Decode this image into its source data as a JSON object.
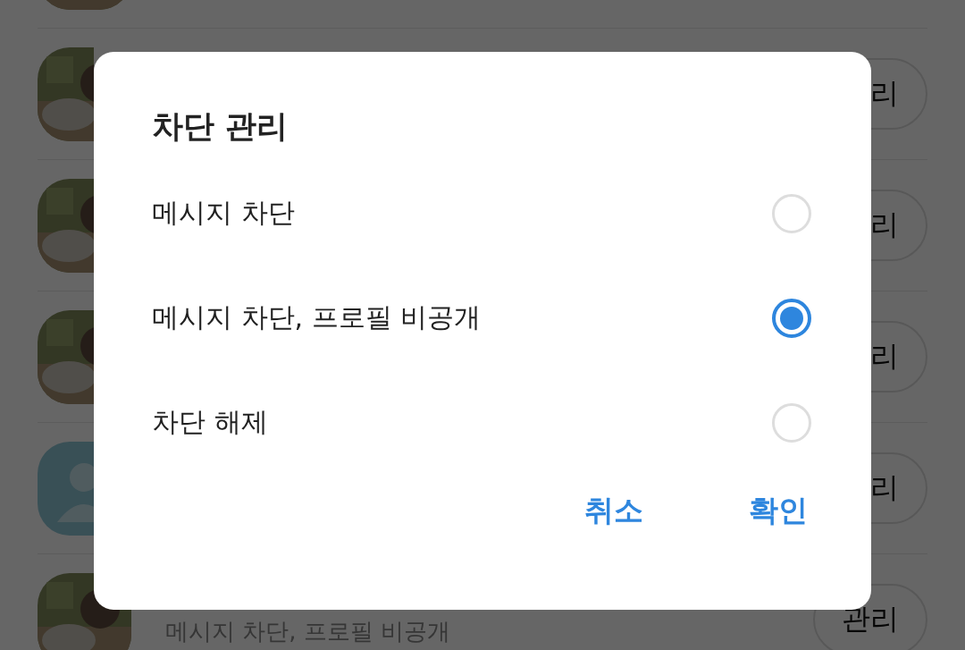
{
  "background_list": {
    "rows": [
      {
        "avatar": {
          "kind": "picture"
        }
      },
      {
        "avatar": {
          "kind": "picture"
        },
        "manage_button": "리"
      },
      {
        "avatar": {
          "kind": "picture"
        },
        "manage_button": "리"
      },
      {
        "avatar": {
          "kind": "picture"
        },
        "manage_button": "리"
      },
      {
        "avatar": {
          "kind": "person"
        },
        "manage_button": "리"
      },
      {
        "avatar": {
          "kind": "picture"
        },
        "manage_button": "관리",
        "subtitle": "메시지 차단, 프로필 비공개"
      }
    ]
  },
  "dialog": {
    "title": "차단 관리",
    "options": [
      {
        "label": "메시지 차단",
        "selected": false
      },
      {
        "label": "메시지 차단, 프로필 비공개",
        "selected": true
      },
      {
        "label": "차단 해제",
        "selected": false
      }
    ],
    "buttons": [
      "취소",
      "확인"
    ]
  }
}
